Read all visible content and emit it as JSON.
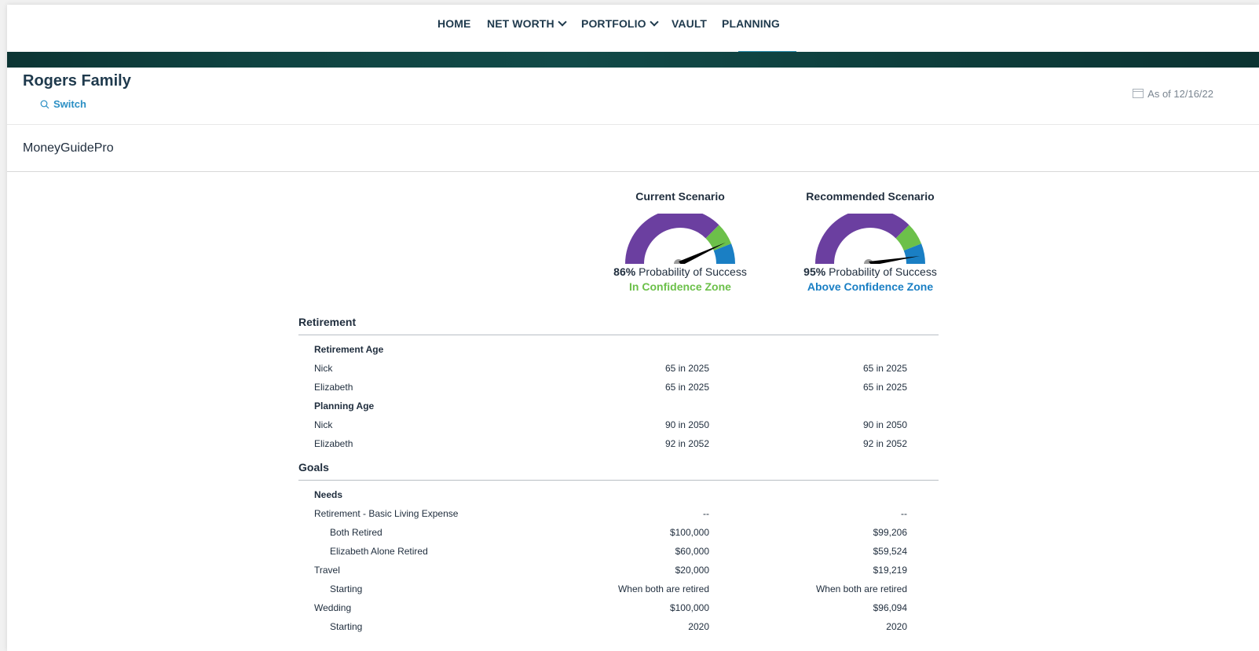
{
  "nav": {
    "items": [
      {
        "label": "HOME",
        "dropdown": false
      },
      {
        "label": "NET WORTH",
        "dropdown": true
      },
      {
        "label": "PORTFOLIO",
        "dropdown": true
      },
      {
        "label": "VAULT",
        "dropdown": false
      },
      {
        "label": "PLANNING",
        "dropdown": false,
        "active": true
      }
    ]
  },
  "header": {
    "family_name": "Rogers Family",
    "switch_label": "Switch",
    "as_of": "As of 12/16/22"
  },
  "section_title": "MoneyGuidePro",
  "scenarios": [
    {
      "title": "Current Scenario",
      "probability": "86%",
      "probability_label": "Probability of Success",
      "zone": "In Confidence Zone",
      "zone_color": "#6cc04a",
      "needle_value": 0.86
    },
    {
      "title": "Recommended Scenario",
      "probability": "95%",
      "probability_label": "Probability of Success",
      "zone": "Above Confidence Zone",
      "zone_color": "#1a7fc4",
      "needle_value": 0.95
    }
  ],
  "gauge_colors": {
    "low": "#6b3fa0",
    "confidence": "#6cc04a",
    "above": "#1a7fc4"
  },
  "retirement": {
    "title": "Retirement",
    "rows": [
      {
        "label": "Retirement Age",
        "type": "sub",
        "c1": "",
        "c2": ""
      },
      {
        "label": "Nick",
        "type": "row",
        "c1": "65 in 2025",
        "c2": "65 in 2025"
      },
      {
        "label": "Elizabeth",
        "type": "row",
        "c1": "65 in 2025",
        "c2": "65 in 2025"
      },
      {
        "label": "Planning Age",
        "type": "sub",
        "c1": "",
        "c2": ""
      },
      {
        "label": "Nick",
        "type": "row",
        "c1": "90 in 2050",
        "c2": "90 in 2050"
      },
      {
        "label": "Elizabeth",
        "type": "row",
        "c1": "92 in 2052",
        "c2": "92 in 2052"
      }
    ]
  },
  "goals": {
    "title": "Goals",
    "rows": [
      {
        "label": "Needs",
        "type": "sub",
        "c1": "",
        "c2": ""
      },
      {
        "label": "Retirement - Basic Living Expense",
        "type": "row",
        "c1": "--",
        "c2": "--"
      },
      {
        "label": "Both Retired",
        "type": "ind",
        "c1": "$100,000",
        "c2": "$99,206"
      },
      {
        "label": "Elizabeth Alone Retired",
        "type": "ind",
        "c1": "$60,000",
        "c2": "$59,524"
      },
      {
        "label": "Travel",
        "type": "row",
        "c1": "$20,000",
        "c2": "$19,219"
      },
      {
        "label": "Starting",
        "type": "ind",
        "c1": "When both are retired",
        "c2": "When both are retired"
      },
      {
        "label": "Wedding",
        "type": "row",
        "c1": "$100,000",
        "c2": "$96,094"
      },
      {
        "label": "Starting",
        "type": "ind",
        "c1": "2020",
        "c2": "2020"
      }
    ]
  }
}
